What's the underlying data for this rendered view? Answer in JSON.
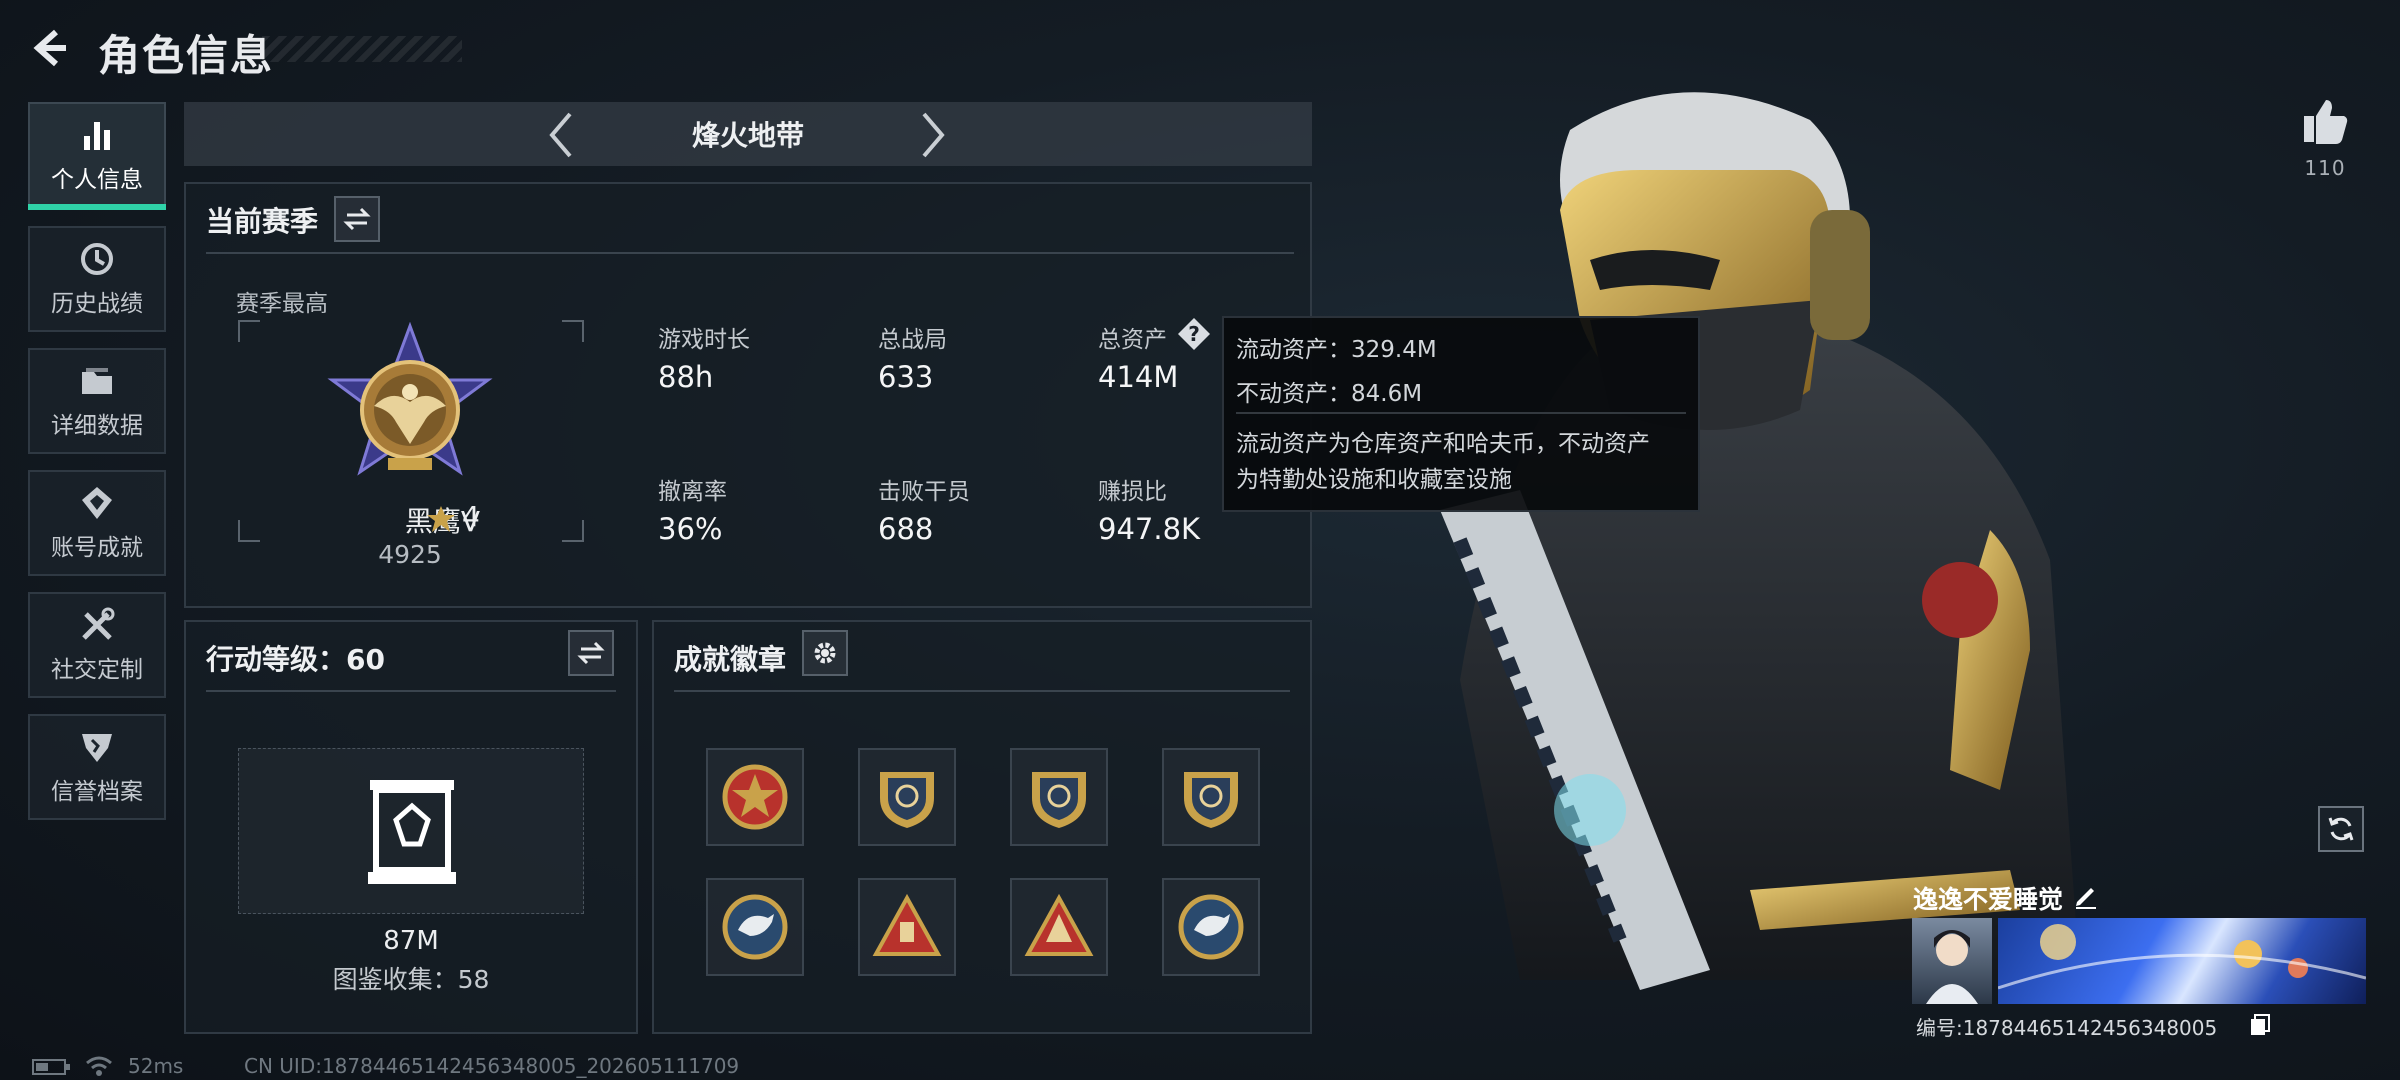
{
  "header": {
    "title": "角色信息"
  },
  "sidebar": {
    "items": [
      {
        "label": "个人信息",
        "icon": "bar-chart-icon",
        "active": true
      },
      {
        "label": "历史战绩",
        "icon": "history-clock-icon",
        "active": false
      },
      {
        "label": "详细数据",
        "icon": "folder-icon",
        "active": false
      },
      {
        "label": "账号成就",
        "icon": "achievement-icon",
        "active": false
      },
      {
        "label": "社交定制",
        "icon": "tools-icon",
        "active": false
      },
      {
        "label": "信誉档案",
        "icon": "credit-shield-icon",
        "active": false
      }
    ]
  },
  "mode": {
    "name": "烽火地带"
  },
  "season": {
    "title": "当前赛季",
    "best_label": "赛季最高",
    "rank_name": "黑鹰Ⅴ",
    "rank_stars": "4",
    "rank_score": "4925",
    "stats": [
      {
        "label": "游戏时长",
        "value": "88h"
      },
      {
        "label": "总战局",
        "value": "633"
      },
      {
        "label": "总资产",
        "value": "414M"
      },
      {
        "label": "撤离率",
        "value": "36%"
      },
      {
        "label": "击败干员",
        "value": "688"
      },
      {
        "label": "赚损比",
        "value": "947.8K"
      }
    ]
  },
  "tooltip": {
    "liquid": "流动资产：329.4M",
    "fixed": "不动资产：84.6M",
    "desc_line1": "流动资产为仓库资产和哈夫币，不动资产",
    "desc_line2": "为特勤处设施和收藏室设施"
  },
  "action_level": {
    "title": "行动等级：60",
    "value": "87M",
    "collection": "图鉴收集：58"
  },
  "achievements": {
    "title": "成就徽章",
    "badges": [
      {
        "icon": "star-badge-icon",
        "color": "#b8322c"
      },
      {
        "icon": "shield-badge-icon",
        "color": "#c9a24a"
      },
      {
        "icon": "shield-badge-icon",
        "color": "#c9a24a"
      },
      {
        "icon": "shield-badge-icon",
        "color": "#c9a24a"
      },
      {
        "icon": "eagle-badge-icon",
        "color": "#2a4a6e"
      },
      {
        "icon": "pyramid-badge-icon",
        "color": "#b8322c"
      },
      {
        "icon": "pyramid-badge-icon",
        "color": "#b8322c"
      },
      {
        "icon": "eagle-badge-icon",
        "color": "#2a4a6e"
      }
    ]
  },
  "likes": {
    "count": "110"
  },
  "player": {
    "name": "逸逸不爱睡觉",
    "id": "编号:1878446514245634800​5"
  },
  "status": {
    "ping": "52ms",
    "uid": "CN UID:18784465142456348005_202605111709"
  },
  "colors": {
    "accent": "#2fd3a8",
    "panel_border": "#303a44",
    "gold": "#c9a24a"
  }
}
